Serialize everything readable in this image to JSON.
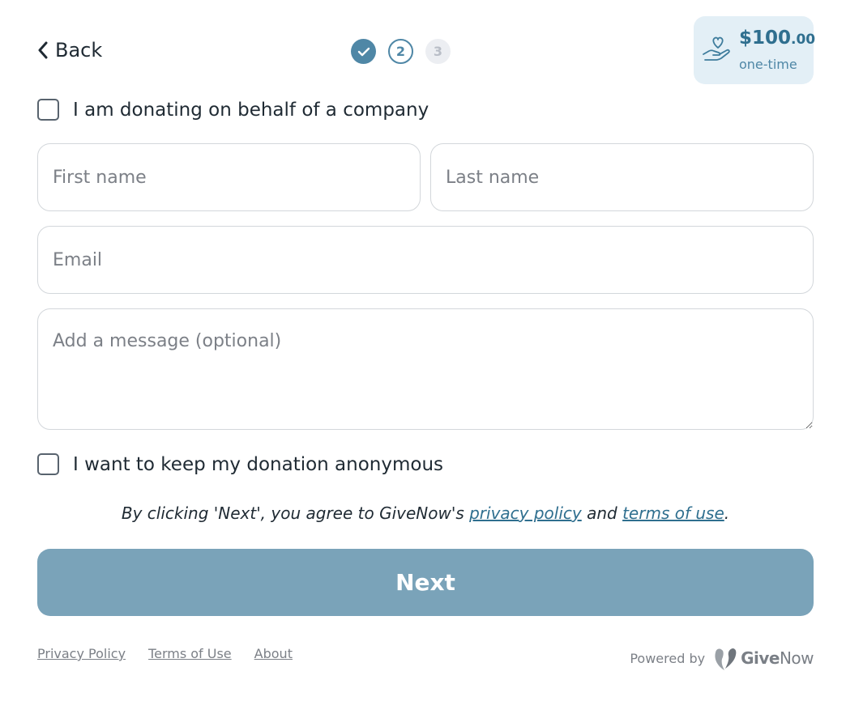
{
  "header": {
    "back_label": "Back",
    "steps": [
      {
        "label": "",
        "state": "done"
      },
      {
        "label": "2",
        "state": "current"
      },
      {
        "label": "3",
        "state": "todo"
      }
    ],
    "amount": {
      "whole": "$100",
      "cents": ".00",
      "frequency": "one-time"
    }
  },
  "form": {
    "company_checkbox_label": "I am donating on behalf of a company",
    "first_name_placeholder": "First name",
    "last_name_placeholder": "Last name",
    "email_placeholder": "Email",
    "message_placeholder": "Add a message (optional)",
    "anonymous_checkbox_label": "I want to keep my donation anonymous"
  },
  "consent": {
    "prefix": "By clicking 'Next', you agree to GiveNow's ",
    "privacy_link": "privacy policy",
    "middle": " and ",
    "terms_link": "terms of use",
    "suffix": "."
  },
  "next_label": "Next",
  "footer": {
    "links": [
      "Privacy Policy",
      "Terms of Use",
      "About"
    ],
    "powered_by": "Powered by",
    "brand_bold": "Give",
    "brand_light": "Now"
  },
  "colors": {
    "accent": "#4f87a6",
    "accent_dark": "#2f6f8f",
    "next_button": "#7aa3b9",
    "amount_card_bg": "#e3eff6"
  },
  "icons": {
    "back": "chevron-left-icon",
    "step_done": "checkmark-icon",
    "amount": "heart-in-hand-icon",
    "brand": "givenow-logo-icon"
  }
}
